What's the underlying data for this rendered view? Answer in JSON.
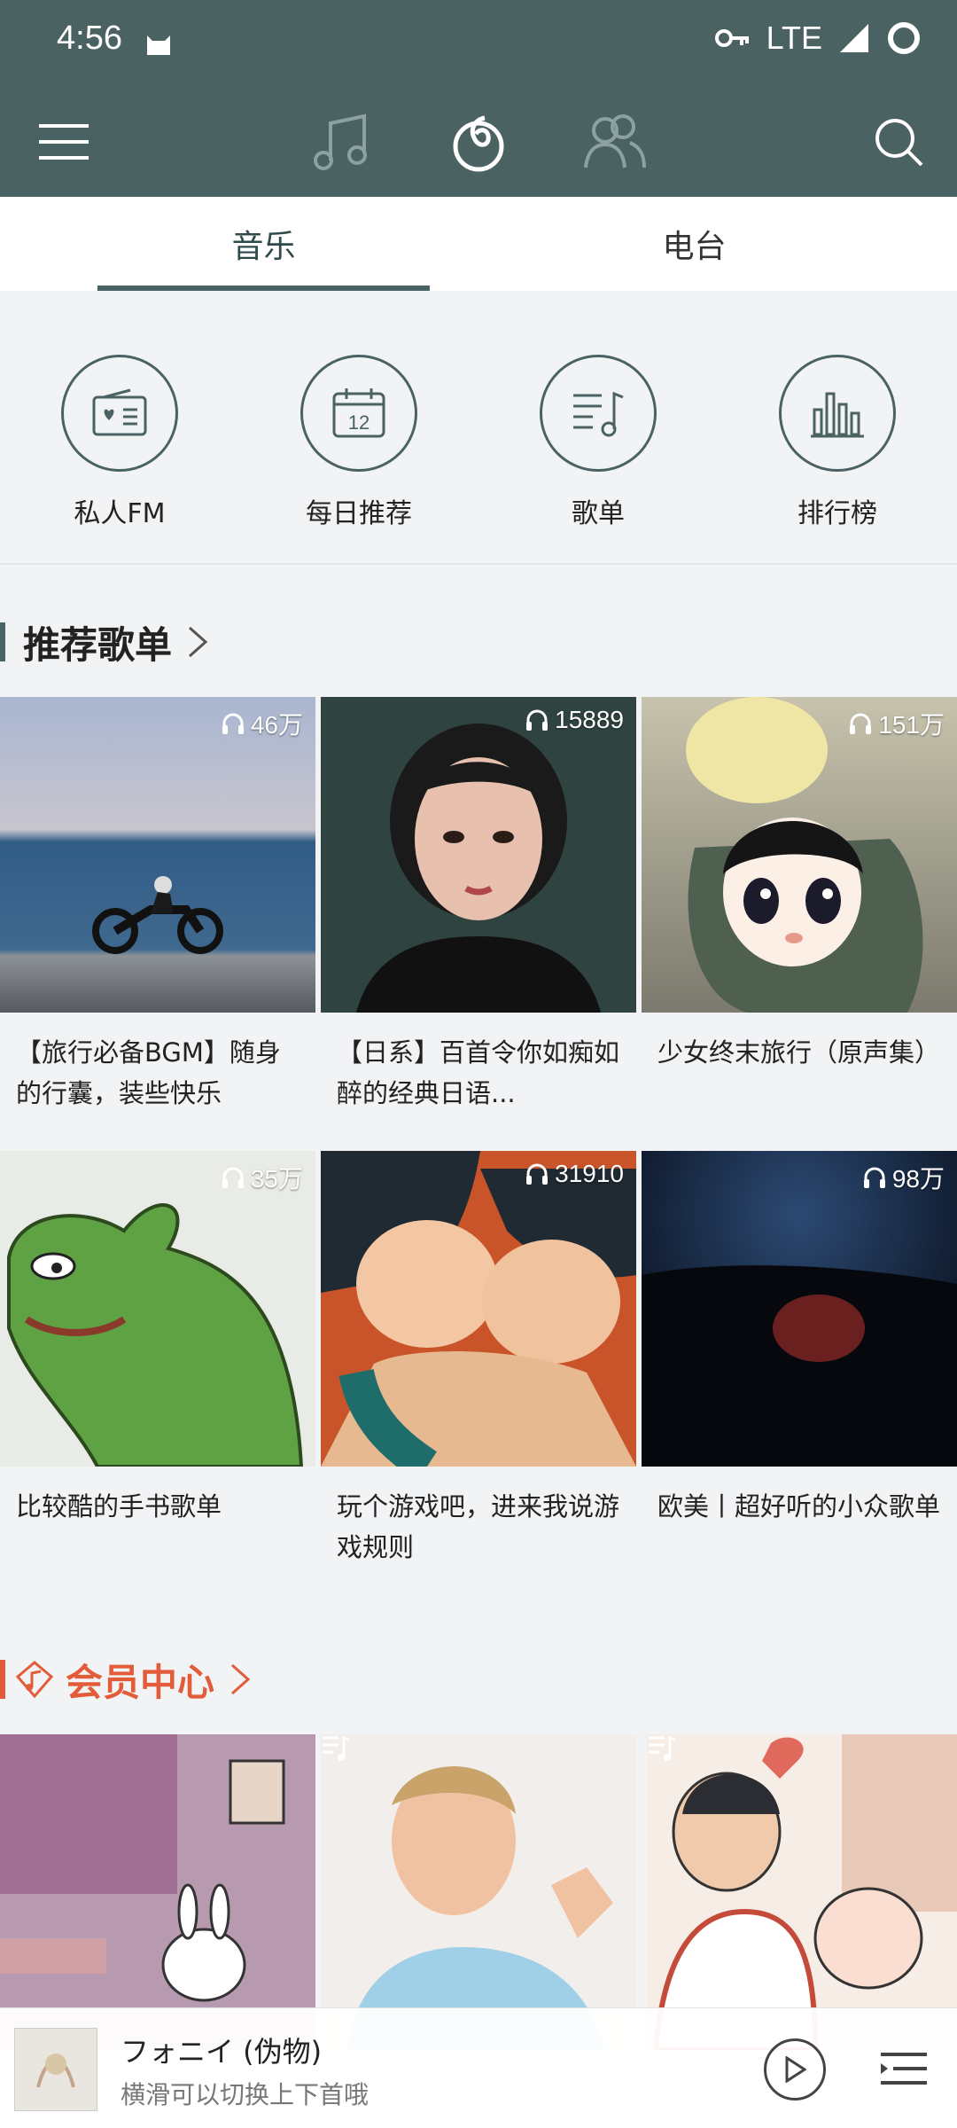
{
  "status": {
    "time": "4:56",
    "network": "LTE"
  },
  "header": {
    "icons": [
      "menu-icon",
      "music-note-icon",
      "netease-logo-icon",
      "friends-icon",
      "search-icon"
    ]
  },
  "tabs": [
    {
      "label": "音乐",
      "active": true
    },
    {
      "label": "电台",
      "active": false
    }
  ],
  "quick": [
    {
      "label": "私人FM",
      "icon": "radio-icon"
    },
    {
      "label": "每日推荐",
      "icon": "calendar-icon",
      "calendar_day": "12"
    },
    {
      "label": "歌单",
      "icon": "playlist-icon"
    },
    {
      "label": "排行榜",
      "icon": "chart-bars-icon"
    }
  ],
  "recommend": {
    "title": "推荐歌单",
    "items": [
      {
        "plays": "46万",
        "title": "【旅行必备BGM】随身的行囊，装些快乐",
        "bg": "#8ca5bf"
      },
      {
        "plays": "15889",
        "title": "【日系】百首令你如痴如醉的经典日语...",
        "bg": "#2f4440"
      },
      {
        "plays": "151万",
        "title": "少女终末旅行（原声集）",
        "bg": "#5d6d5c"
      },
      {
        "plays": "35万",
        "title": "比较酷的手书歌单",
        "bg": "#e9ece6"
      },
      {
        "plays": "31910",
        "title": "玩个游戏吧，进来我说游戏规则",
        "bg": "#c9542a"
      },
      {
        "plays": "98万",
        "title": "欧美丨超好听的小众歌单",
        "bg": "#0f1a2c"
      }
    ]
  },
  "vip": {
    "title": "会员中心",
    "items": [
      {
        "bg": "#b79ab0"
      },
      {
        "bg": "#f1eeec"
      },
      {
        "bg": "#f6ede6"
      }
    ]
  },
  "player": {
    "title": "フォニイ (伪物)",
    "subtitle": "横滑可以切换上下首哦"
  },
  "colors": {
    "primary": "#4b6263",
    "vip": "#e35c3a",
    "background": "#f2f3f5"
  }
}
